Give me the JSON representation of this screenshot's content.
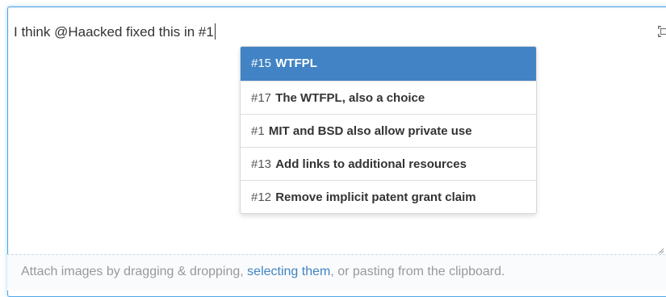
{
  "editor": {
    "text": "I think @Haacked fixed this in #1",
    "fullscreen_icon": "fullscreen-icon"
  },
  "suggestions": [
    {
      "number": "#15",
      "title": "WTFPL",
      "selected": true
    },
    {
      "number": "#17",
      "title": "The WTFPL, also a choice",
      "selected": false
    },
    {
      "number": "#1",
      "title": "MIT and BSD also allow private use",
      "selected": false
    },
    {
      "number": "#13",
      "title": "Add links to additional resources",
      "selected": false
    },
    {
      "number": "#12",
      "title": "Remove implicit patent grant claim",
      "selected": false
    }
  ],
  "attach_bar": {
    "prefix": "Attach images by dragging & dropping, ",
    "link": "selecting them",
    "suffix": ", or pasting from the clipboard."
  },
  "colors": {
    "focus_border": "#51a7e8",
    "selected_bg": "#4183c4",
    "link": "#4183c4"
  }
}
